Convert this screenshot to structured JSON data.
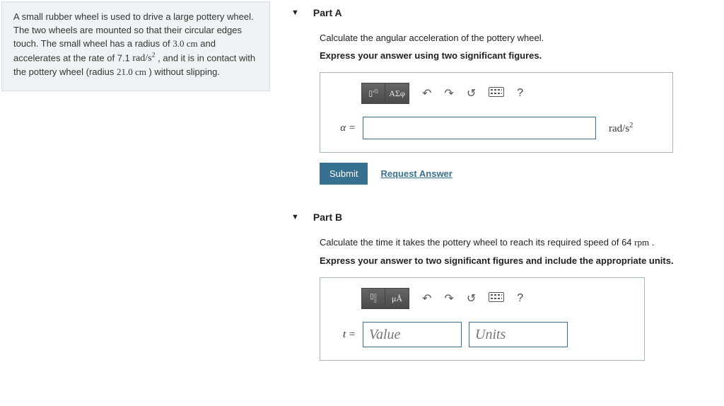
{
  "problem": {
    "text_prefix": "A small rubber wheel is used to drive a large pottery wheel. The two wheels are mounted so that their circular edges touch. The small wheel has a radius of ",
    "radius_small": "3.0 cm",
    "text_mid1": " and accelerates at the rate of 7.1 ",
    "rate_unit": "rad/s²",
    "text_mid2": " , and it is in contact with the pottery wheel (radius ",
    "radius_large": "21.0 cm",
    "text_suffix": " ) without slipping."
  },
  "partA": {
    "title": "Part A",
    "prompt": "Calculate the angular acceleration of the pottery wheel.",
    "instruct": "Express your answer using two significant figures.",
    "toolbar": {
      "greek": "ΑΣφ",
      "help": "?"
    },
    "var": "α =",
    "value": "",
    "unit": "rad/s²",
    "submit": "Submit",
    "request": "Request Answer"
  },
  "partB": {
    "title": "Part B",
    "prompt_prefix": "Calculate the time it takes the pottery wheel to reach its required speed of 64 ",
    "prompt_unit": "rpm",
    "prompt_suffix": " .",
    "instruct": "Express your answer to two significant figures and include the appropriate units.",
    "toolbar": {
      "units_btn": "μÅ",
      "help": "?"
    },
    "var": "t =",
    "value_placeholder": "Value",
    "units_placeholder": "Units"
  }
}
